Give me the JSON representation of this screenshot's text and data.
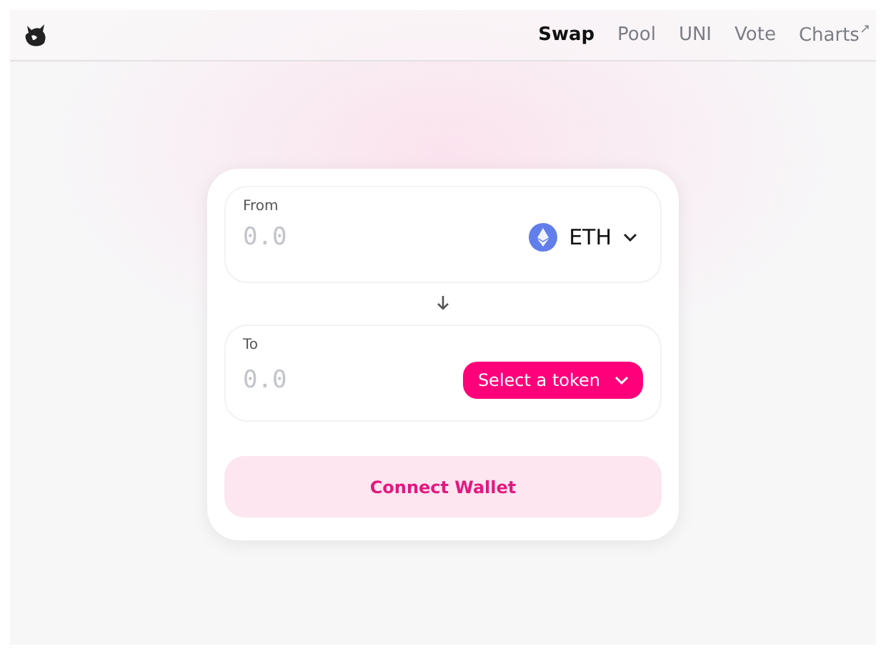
{
  "nav": [
    {
      "label": "Swap",
      "selected": true
    },
    {
      "label": "Pool",
      "selected": false
    },
    {
      "label": "UNI",
      "selected": false
    },
    {
      "label": "Vote",
      "selected": false
    },
    {
      "label": "Charts",
      "selected": false,
      "external": "↗"
    }
  ],
  "panels": [
    {
      "label": "From",
      "placeholder": "0.0",
      "token": {
        "kind": "token",
        "label": "ETH"
      }
    },
    {
      "label": "To",
      "placeholder": "0.0",
      "token": {
        "kind": "select",
        "label": "Select a token"
      }
    }
  ],
  "connect_button": "Connect Wallet"
}
